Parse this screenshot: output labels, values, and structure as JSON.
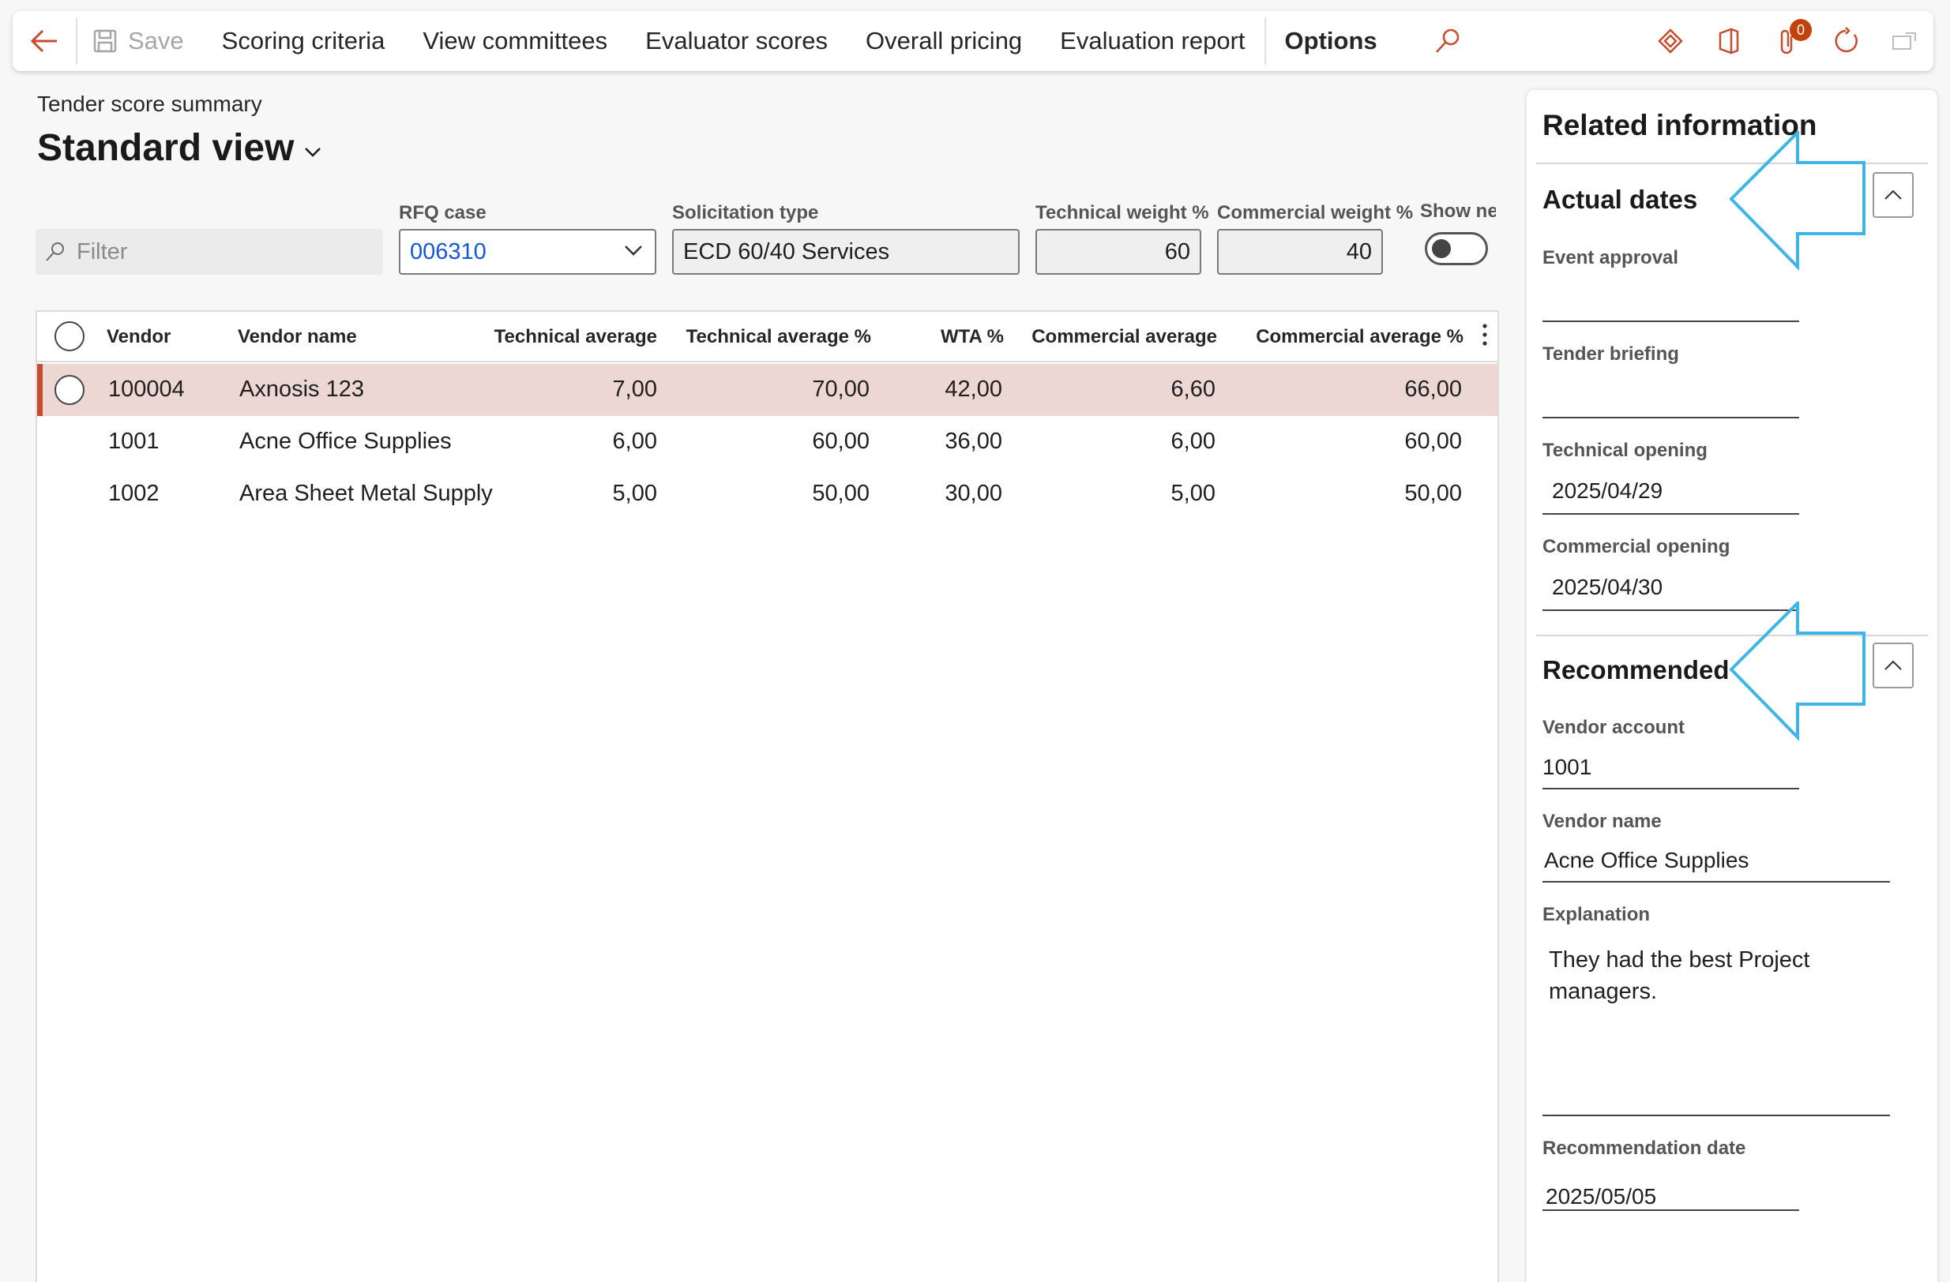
{
  "toolbar": {
    "save_label": "Save",
    "items": [
      "Scoring criteria",
      "View committees",
      "Evaluator scores",
      "Overall pricing",
      "Evaluation report"
    ],
    "options_label": "Options",
    "attachments_count": "0"
  },
  "page": {
    "caption": "Tender score summary",
    "view_title": "Standard view"
  },
  "filters": {
    "filter_placeholder": "Filter",
    "rfq_label": "RFQ case",
    "rfq_value": "006310",
    "solicitation_label": "Solicitation type",
    "solicitation_value": "ECD 60/40 Services",
    "tech_weight_label": "Technical weight %",
    "tech_weight_value": "60",
    "comm_weight_label": "Commercial weight %",
    "comm_weight_value": "40",
    "show_label": "Show ne",
    "show_toggle_on": false
  },
  "grid": {
    "headers": [
      "Vendor",
      "Vendor name",
      "Technical average",
      "Technical average %",
      "WTA %",
      "Commercial average",
      "Commercial average %"
    ],
    "rows": [
      {
        "vendor": "100004",
        "name": "Axnosis 123",
        "tech_avg": "7,00",
        "tech_avg_pct": "70,00",
        "wta": "42,00",
        "comm_avg": "6,60",
        "comm_avg_pct": "66,00"
      },
      {
        "vendor": "1001",
        "name": "Acne Office Supplies",
        "tech_avg": "6,00",
        "tech_avg_pct": "60,00",
        "wta": "36,00",
        "comm_avg": "6,00",
        "comm_avg_pct": "60,00"
      },
      {
        "vendor": "1002",
        "name": "Area Sheet Metal Supply",
        "tech_avg": "5,00",
        "tech_avg_pct": "50,00",
        "wta": "30,00",
        "comm_avg": "5,00",
        "comm_avg_pct": "50,00"
      }
    ]
  },
  "related": {
    "title": "Related information",
    "actual_dates": {
      "title": "Actual dates",
      "event_approval_label": "Event approval",
      "event_approval_value": "",
      "tender_briefing_label": "Tender briefing",
      "tender_briefing_value": "",
      "technical_opening_label": "Technical opening",
      "technical_opening_value": "2025/04/29",
      "commercial_opening_label": "Commercial opening",
      "commercial_opening_value": "2025/04/30"
    },
    "recommended": {
      "title": "Recommended",
      "vendor_account_label": "Vendor account",
      "vendor_account_value": "1001",
      "vendor_name_label": "Vendor name",
      "vendor_name_value": "Acne Office Supplies",
      "explanation_label": "Explanation",
      "explanation_value": "They had the best Project managers.",
      "recommendation_date_label": "Recommendation date",
      "recommendation_date_value": "2025/05/05"
    }
  },
  "colors": {
    "accent": "#c54c2e",
    "selected_row": "#ecd7d3",
    "link": "#1457d6",
    "callout": "#3fb4e8"
  }
}
